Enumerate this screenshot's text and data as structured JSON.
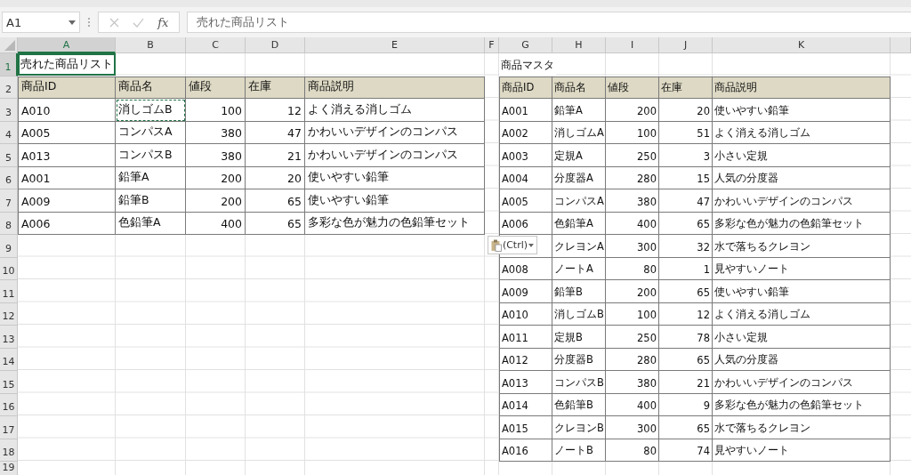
{
  "name_box": {
    "value": "A1"
  },
  "formula_bar": {
    "cancel_disabled": true,
    "function_label": "fx",
    "value": "売れた商品リスト"
  },
  "columns": [
    {
      "label": "A",
      "selected": true
    },
    {
      "label": "B",
      "selected": false
    },
    {
      "label": "C",
      "selected": false
    },
    {
      "label": "D",
      "selected": false
    },
    {
      "label": "E",
      "selected": false
    },
    {
      "label": "F",
      "selected": false
    },
    {
      "label": "G",
      "selected": false
    },
    {
      "label": "H",
      "selected": false
    },
    {
      "label": "I",
      "selected": false
    },
    {
      "label": "J",
      "selected": false
    },
    {
      "label": "K",
      "selected": false
    }
  ],
  "row_numbers": [
    {
      "label": "1",
      "selected": true
    },
    {
      "label": "2",
      "selected": false
    },
    {
      "label": "3",
      "selected": false
    },
    {
      "label": "4",
      "selected": false
    },
    {
      "label": "5",
      "selected": false
    },
    {
      "label": "6",
      "selected": false
    },
    {
      "label": "7",
      "selected": false
    },
    {
      "label": "8",
      "selected": false
    },
    {
      "label": "9",
      "selected": false
    },
    {
      "label": "10",
      "selected": false
    },
    {
      "label": "11",
      "selected": false
    },
    {
      "label": "12",
      "selected": false
    },
    {
      "label": "13",
      "selected": false
    },
    {
      "label": "14",
      "selected": false
    },
    {
      "label": "15",
      "selected": false
    },
    {
      "label": "16",
      "selected": false
    },
    {
      "label": "17",
      "selected": false
    },
    {
      "label": "18",
      "selected": false
    },
    {
      "label": "19",
      "selected": false
    }
  ],
  "sold_list": {
    "title": {
      "text": "売れた商品リスト",
      "selected": true
    },
    "headers": [
      "商品ID",
      "商品名",
      "値段",
      "在庫",
      "商品説明"
    ],
    "rows": [
      {
        "id": "A010",
        "name": "消しゴムB",
        "name_copied": true,
        "price": "100",
        "stock": "12",
        "description": "よく消える消しゴム"
      },
      {
        "id": "A005",
        "name": "コンパスA",
        "name_copied": false,
        "price": "380",
        "stock": "47",
        "description": "かわいいデザインのコンパス"
      },
      {
        "id": "A013",
        "name": "コンパスB",
        "name_copied": false,
        "price": "380",
        "stock": "21",
        "description": "かわいいデザインのコンパス"
      },
      {
        "id": "A001",
        "name": "鉛筆A",
        "name_copied": false,
        "price": "200",
        "stock": "20",
        "description": "使いやすい鉛筆"
      },
      {
        "id": "A009",
        "name": "鉛筆B",
        "name_copied": false,
        "price": "200",
        "stock": "65",
        "description": "使いやすい鉛筆"
      },
      {
        "id": "A006",
        "name": "色鉛筆A",
        "name_copied": false,
        "price": "400",
        "stock": "65",
        "description": "多彩な色が魅力の色鉛筆セット"
      }
    ]
  },
  "master": {
    "title": {
      "text": "商品マスタ",
      "selected": false
    },
    "headers": [
      "商品ID",
      "商品名",
      "値段",
      "在庫",
      "商品説明"
    ],
    "rows": [
      {
        "id": "A001",
        "name": "鉛筆A",
        "price": "200",
        "stock": "20",
        "description": "使いやすい鉛筆"
      },
      {
        "id": "A002",
        "name": "消しゴムA",
        "price": "100",
        "stock": "51",
        "description": "よく消える消しゴム"
      },
      {
        "id": "A003",
        "name": "定規A",
        "price": "250",
        "stock": "3",
        "description": "小さい定規"
      },
      {
        "id": "A004",
        "name": "分度器A",
        "price": "280",
        "stock": "15",
        "description": "人気の分度器"
      },
      {
        "id": "A005",
        "name": "コンパスA",
        "price": "380",
        "stock": "47",
        "description": "かわいいデザインのコンパス"
      },
      {
        "id": "A006",
        "name": "色鉛筆A",
        "price": "400",
        "stock": "65",
        "description": "多彩な色が魅力の色鉛筆セット"
      },
      {
        "name": "クレヨンA",
        "price": "300",
        "stock": "32",
        "description": "水で落ちるクレヨン"
      },
      {
        "id": "A008",
        "name": "ノートA",
        "price": "80",
        "stock": "1",
        "description": "見やすいノート"
      },
      {
        "id": "A009",
        "name": "鉛筆B",
        "price": "200",
        "stock": "65",
        "description": "使いやすい鉛筆"
      },
      {
        "id": "A010",
        "name": "消しゴムB",
        "price": "100",
        "stock": "12",
        "description": "よく消える消しゴム"
      },
      {
        "id": "A011",
        "name": "定規B",
        "price": "250",
        "stock": "78",
        "description": "小さい定規"
      },
      {
        "id": "A012",
        "name": "分度器B",
        "price": "280",
        "stock": "65",
        "description": "人気の分度器"
      },
      {
        "id": "A013",
        "name": "コンパスB",
        "price": "380",
        "stock": "21",
        "description": "かわいいデザインのコンパス"
      },
      {
        "id": "A014",
        "name": "色鉛筆B",
        "price": "400",
        "stock": "9",
        "description": "多彩な色が魅力の色鉛筆セット"
      },
      {
        "id": "A015",
        "name": "クレヨンB",
        "price": "300",
        "stock": "65",
        "description": "水で落ちるクレヨン"
      },
      {
        "id": "A016",
        "name": "ノートB",
        "price": "80",
        "stock": "74",
        "description": "見やすいノート"
      }
    ]
  },
  "paste_options": {
    "label": "(Ctrl)"
  }
}
